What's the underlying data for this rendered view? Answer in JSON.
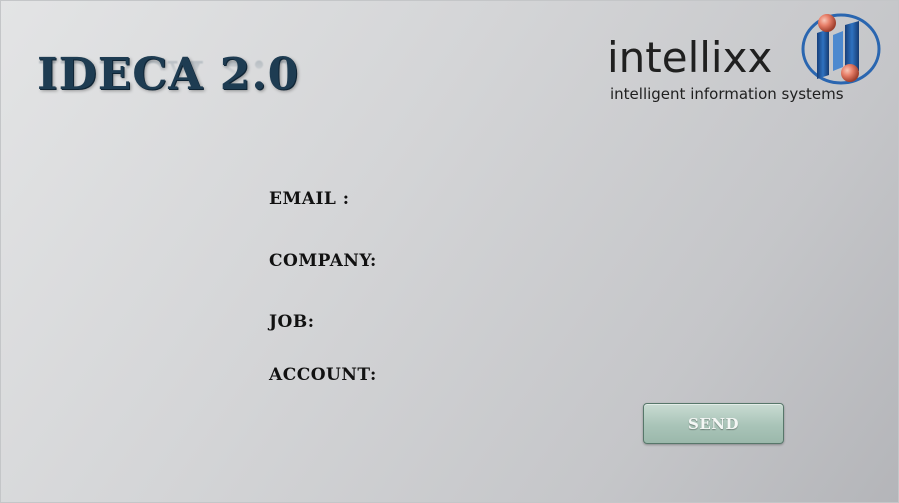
{
  "app": {
    "title": "IDECA 2.0"
  },
  "logo": {
    "wordmark": "intellixx",
    "tagline": "intelligent information systems",
    "icon": "intellixx-logo-icon",
    "colors": {
      "blue": "#2a66b0",
      "orb": "#e8806a"
    }
  },
  "form": {
    "email_label": "EMAIL :",
    "company_label": "COMPANY:",
    "job_label": "JOB:",
    "account_label": "ACCOUNT:"
  },
  "actions": {
    "send_label": "SEND"
  },
  "colors": {
    "title": "#1e3c52",
    "button": "#a9c4b8",
    "button_border": "#57776a"
  }
}
